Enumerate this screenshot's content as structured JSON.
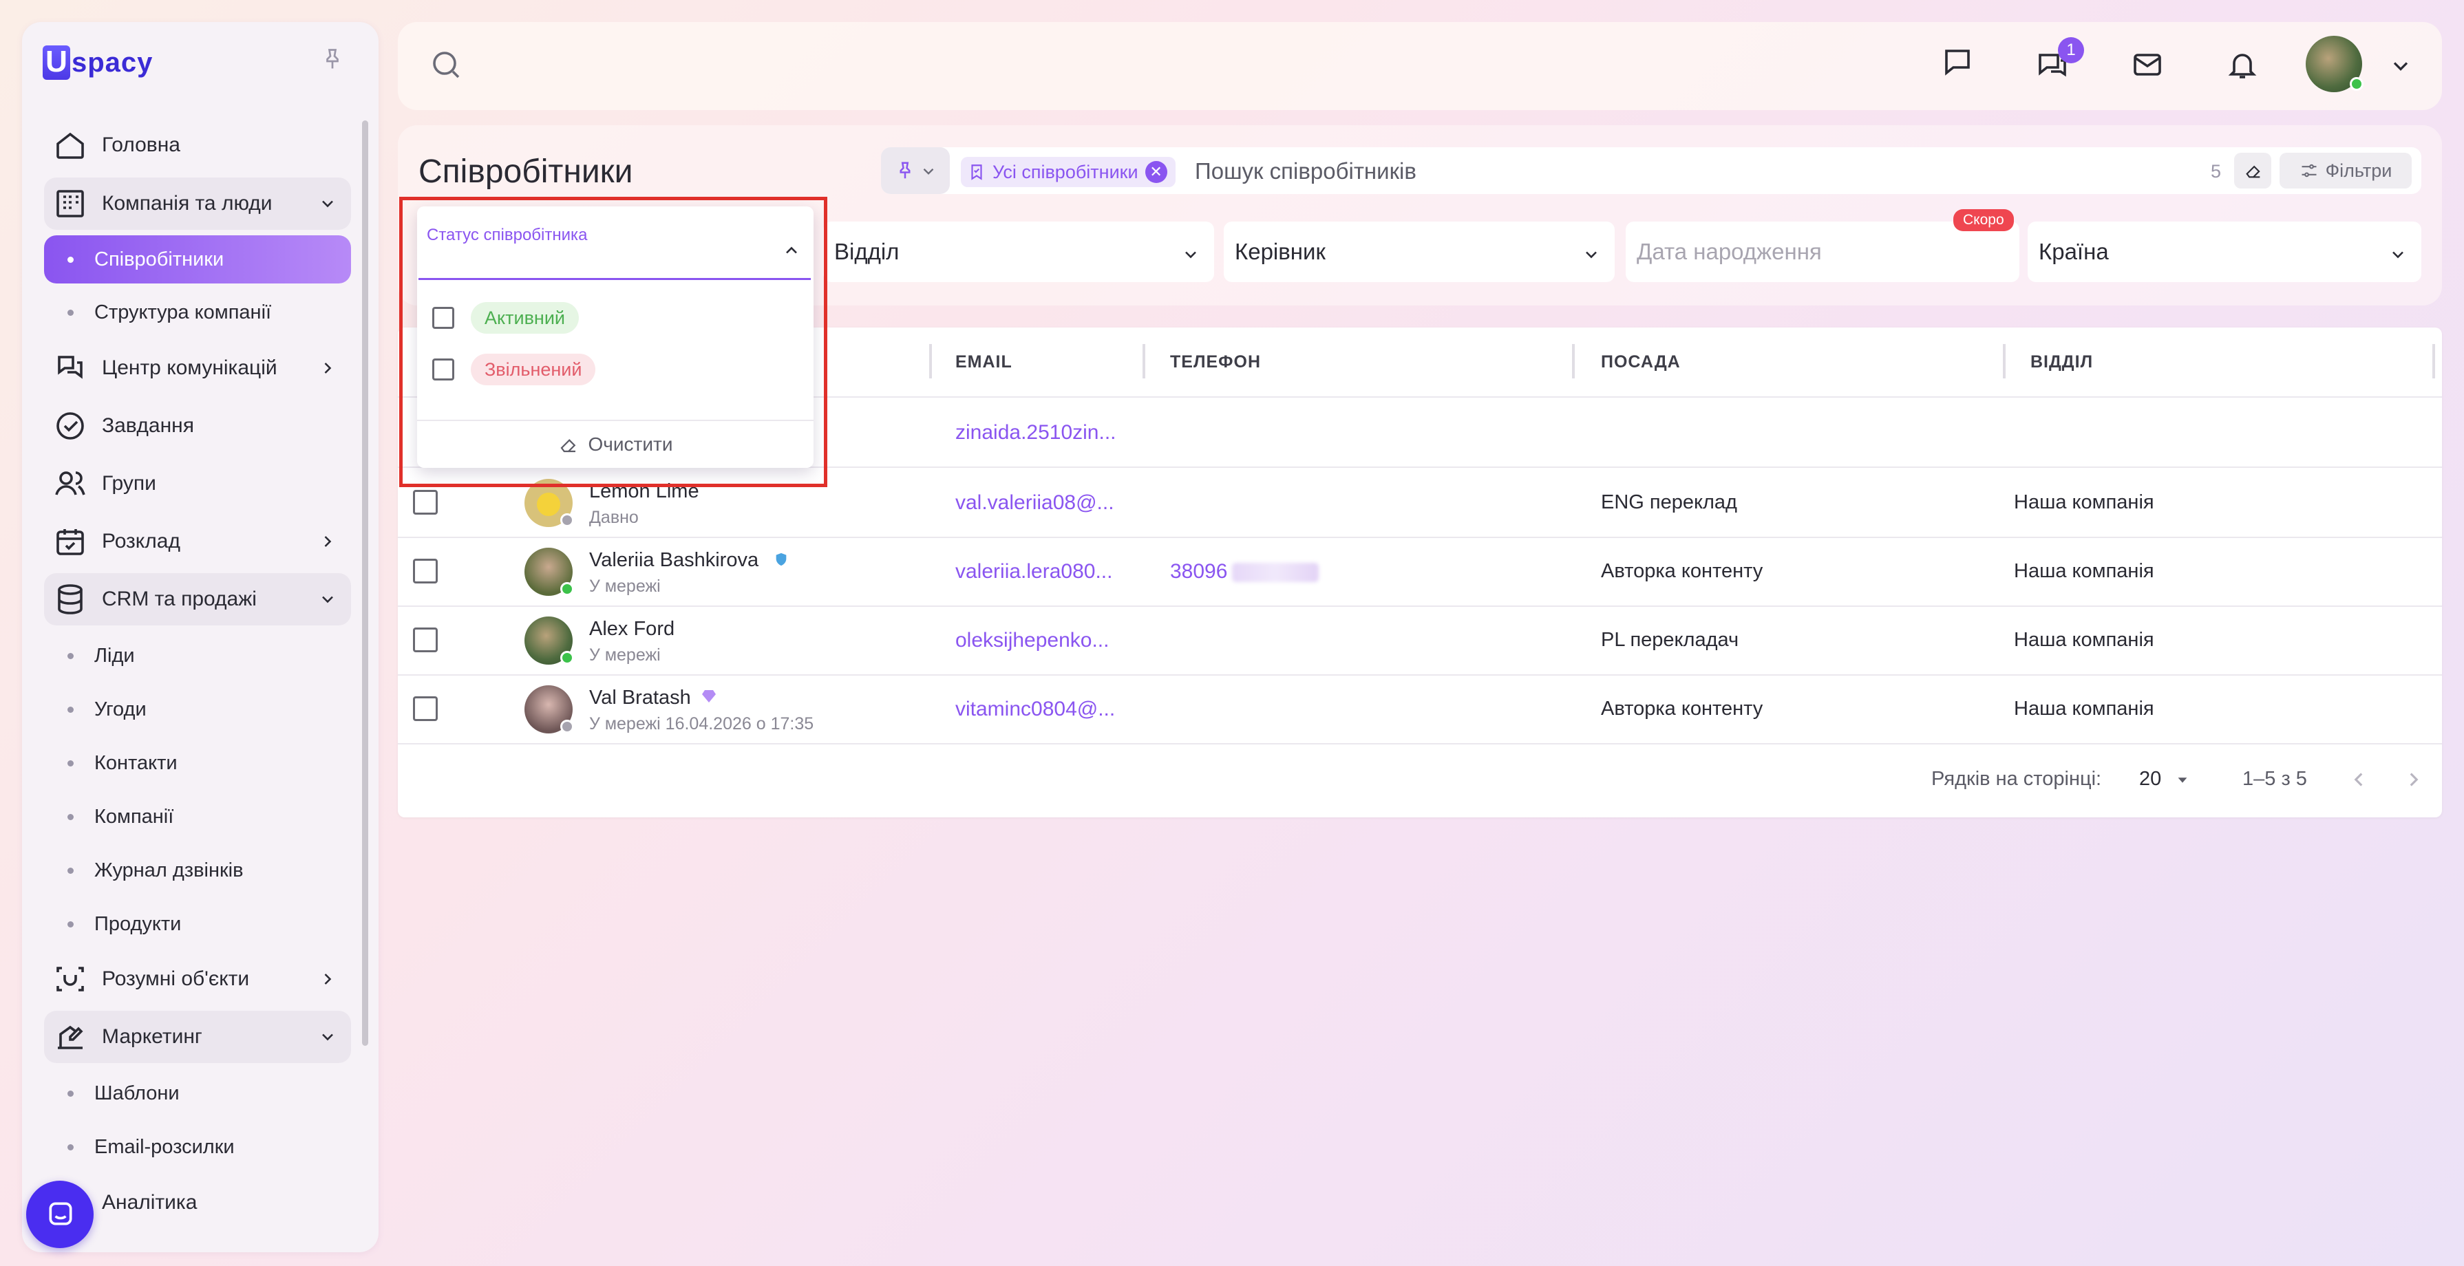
{
  "app": {
    "logo_text": "spacy",
    "logo_letter": "U"
  },
  "sidebar": {
    "items": [
      {
        "label": "Головна",
        "icon": "home-icon"
      },
      {
        "label": "Компанія та люди",
        "icon": "building-icon",
        "expanded": true,
        "children": [
          {
            "label": "Співробітники",
            "active": true
          },
          {
            "label": "Структура компанії"
          }
        ]
      },
      {
        "label": "Центр комунікацій",
        "icon": "communication-icon"
      },
      {
        "label": "Завдання",
        "icon": "check-circle-icon"
      },
      {
        "label": "Групи",
        "icon": "users-icon"
      },
      {
        "label": "Розклад",
        "icon": "calendar-icon"
      },
      {
        "label": "CRM та продажі",
        "icon": "database-icon",
        "expanded": true,
        "children": [
          {
            "label": "Ліди"
          },
          {
            "label": "Угоди"
          },
          {
            "label": "Контакти"
          },
          {
            "label": "Компанії"
          },
          {
            "label": "Журнал дзвінків"
          },
          {
            "label": "Продукти"
          }
        ]
      },
      {
        "label": "Розумні об'єкти",
        "icon": "smart-object-icon"
      },
      {
        "label": "Маркетинг",
        "icon": "marketing-icon",
        "expanded": true,
        "children": [
          {
            "label": "Шаблони"
          },
          {
            "label": "Email-розсилки"
          }
        ]
      },
      {
        "label": "Аналітика",
        "icon": "analytics-icon"
      }
    ]
  },
  "header": {
    "chat_badge": "1"
  },
  "page": {
    "title": "Співробітники",
    "filter_chip": "Усі співробітники",
    "search_placeholder": "Пошук співробітників",
    "count": "5",
    "filters_label": "Фільтри",
    "filters": {
      "status": "Статус співробітника",
      "department": "Відділ",
      "manager": "Керівник",
      "birthdate": "Дата народження",
      "soon_badge": "Скоро",
      "country": "Країна"
    }
  },
  "status_dropdown": {
    "options": [
      {
        "label": "Активний",
        "color": "#4caf50",
        "bg": "#e6f6e4"
      },
      {
        "label": "Звільнений",
        "color": "#e25c6a",
        "bg": "#fbe5e8"
      }
    ],
    "clear_label": "Очистити"
  },
  "table": {
    "headers": [
      "EMAIL",
      "ТЕЛЕФОН",
      "ПОСАДА",
      "ВІДДІЛ"
    ],
    "rows": [
      {
        "name": "",
        "status": "",
        "email": "zinaida.2510zin...",
        "phone": "",
        "position": "",
        "department": ""
      },
      {
        "name": "Lemon Lime",
        "status": "Давно",
        "email": "val.valeriia08@...",
        "phone": "",
        "position": "ENG переклад",
        "department": "Наша компанія"
      },
      {
        "name": "Valeriia Bashkirova",
        "status": "У мережі",
        "email": "valeriia.lera080...",
        "phone": "38096",
        "position": "Авторка контенту",
        "department": "Наша компанія"
      },
      {
        "name": "Alex Ford",
        "status": "У мережі",
        "email": "oleksijhepenko...",
        "phone": "",
        "position": "PL перекладач",
        "department": "Наша компанія"
      },
      {
        "name": "Val Bratash",
        "status": "У мережі 16.04.2026 о 17:35",
        "email": "vitaminc0804@...",
        "phone": "",
        "position": "Авторка контенту",
        "department": "Наша компанія"
      }
    ],
    "footer": {
      "rows_per_page_label": "Рядків на сторінці:",
      "rows_per_page": "20",
      "range": "1–5 з 5"
    }
  }
}
